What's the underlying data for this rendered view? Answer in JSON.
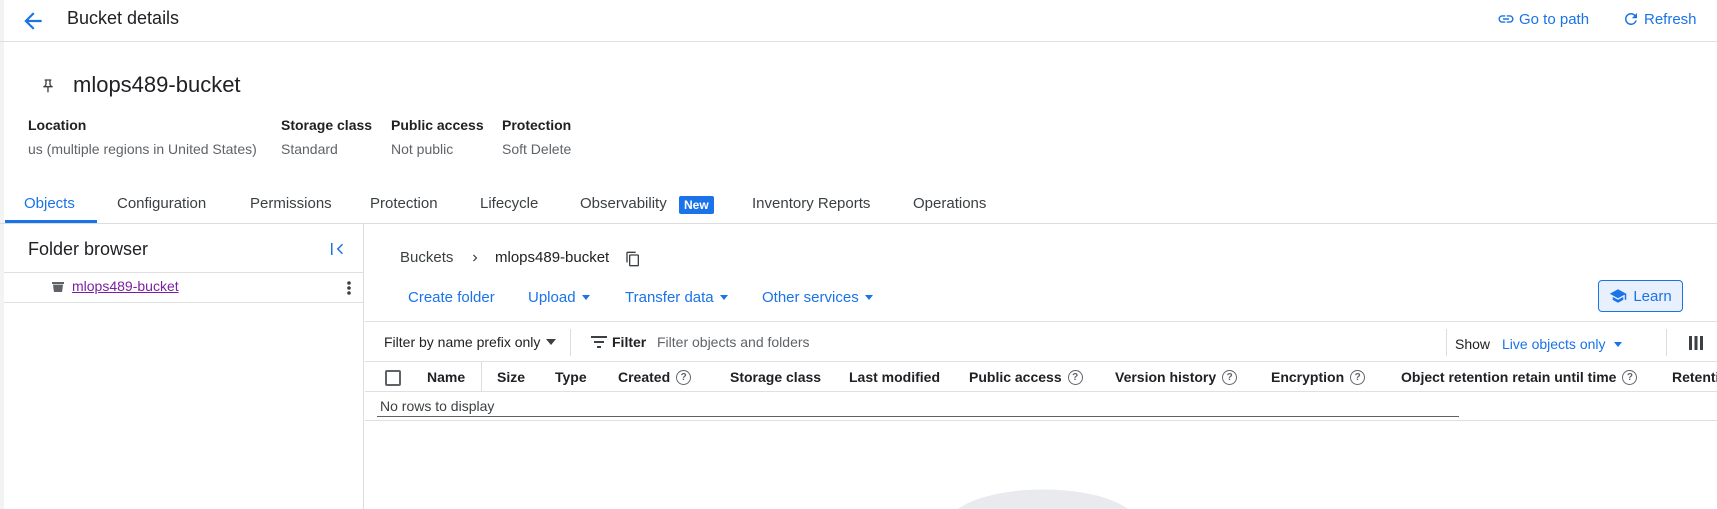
{
  "header": {
    "title": "Bucket details",
    "go_to_path": "Go to path",
    "refresh": "Refresh"
  },
  "bucket": {
    "name": "mlops489-bucket",
    "meta": [
      {
        "label": "Location",
        "value": "us (multiple regions in United States)"
      },
      {
        "label": "Storage class",
        "value": "Standard"
      },
      {
        "label": "Public access",
        "value": "Not public"
      },
      {
        "label": "Protection",
        "value": "Soft Delete"
      }
    ]
  },
  "tabs": [
    {
      "label": "Objects",
      "active": true
    },
    {
      "label": "Configuration"
    },
    {
      "label": "Permissions"
    },
    {
      "label": "Protection"
    },
    {
      "label": "Lifecycle"
    },
    {
      "label": "Observability",
      "badge": "New"
    },
    {
      "label": "Inventory Reports"
    },
    {
      "label": "Operations"
    }
  ],
  "folder_browser": {
    "title": "Folder browser",
    "bucket": "mlops489-bucket"
  },
  "breadcrumb": {
    "root": "Buckets",
    "current": "mlops489-bucket"
  },
  "actions": {
    "create_folder": "Create folder",
    "upload": "Upload",
    "transfer_data": "Transfer data",
    "other_services": "Other services",
    "learn": "Learn"
  },
  "filter": {
    "prefix_mode": "Filter by name prefix only",
    "label": "Filter",
    "placeholder": "Filter objects and folders",
    "show_label": "Show",
    "show_value": "Live objects only"
  },
  "table": {
    "columns": [
      {
        "label": "Name"
      },
      {
        "label": "Size"
      },
      {
        "label": "Type"
      },
      {
        "label": "Created",
        "help": true
      },
      {
        "label": "Storage class"
      },
      {
        "label": "Last modified"
      },
      {
        "label": "Public access",
        "help": true
      },
      {
        "label": "Version history",
        "help": true
      },
      {
        "label": "Encryption",
        "help": true
      },
      {
        "label": "Object retention retain until time",
        "help": true
      },
      {
        "label": "Retenti"
      }
    ],
    "empty_text": "No rows to display"
  },
  "colors": {
    "accent": "#1a73e8",
    "visited_link": "#7b1fa2"
  }
}
